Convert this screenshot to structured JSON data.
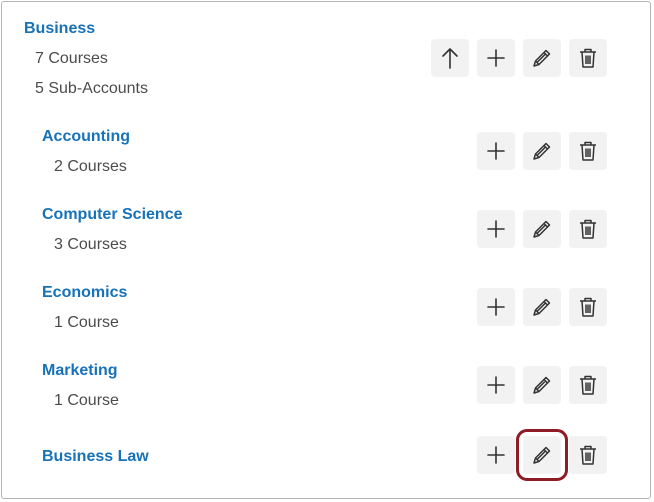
{
  "parent": {
    "name": "Business",
    "courses": "7 Courses",
    "sub_accounts": "5 Sub-Accounts"
  },
  "sub_accounts": [
    {
      "name": "Accounting",
      "courses": "2 Courses"
    },
    {
      "name": "Computer Science",
      "courses": "3 Courses"
    },
    {
      "name": "Economics",
      "courses": "1 Course"
    },
    {
      "name": "Marketing",
      "courses": "1 Course"
    },
    {
      "name": "Business Law",
      "courses": ""
    }
  ],
  "icons": {
    "up": "arrow-up-icon",
    "add": "plus-icon",
    "edit": "pencil-icon",
    "delete": "trash-icon"
  },
  "colors": {
    "link": "#1772b8",
    "meta_text": "#4c4c4c",
    "button_bg": "#f2f2f2",
    "highlight": "#8f1b26"
  }
}
